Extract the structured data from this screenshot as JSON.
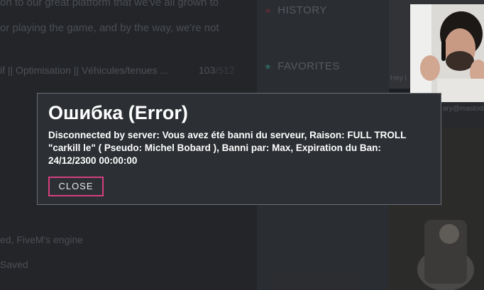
{
  "background": {
    "intro_line_1": "on to our great platform that we've all grown to",
    "intro_line_2": "or playing the game, and by the way, we're not",
    "server_name": "if || Optimisation || Véhicules/tenues ...",
    "server_players": "103",
    "server_max": "/512",
    "footer_line_1": "ed, FiveM's engine",
    "footer_line_2": "Saved",
    "tabs": {
      "history": "HISTORY",
      "favorites": "FAVORITES"
    },
    "thumb_label_1": "Hey l",
    "thumb_label_2": "ary@mastodo"
  },
  "icons": {
    "history": "star-icon",
    "favorites": "star-icon",
    "accent_pink": "#d43f7e",
    "accent_teal": "#3f8e88"
  },
  "error_dialog": {
    "title": "Ошибка (Error)",
    "message": "Disconnected by server: Vous avez été banni du serveur, Raison: FULL TROLL \"carkill le\" ( Pseudo: Michel Bobard ), Banni par: Max, Expiration du Ban: 24/12/2300 00:00:00",
    "close_label": "CLOSE"
  }
}
